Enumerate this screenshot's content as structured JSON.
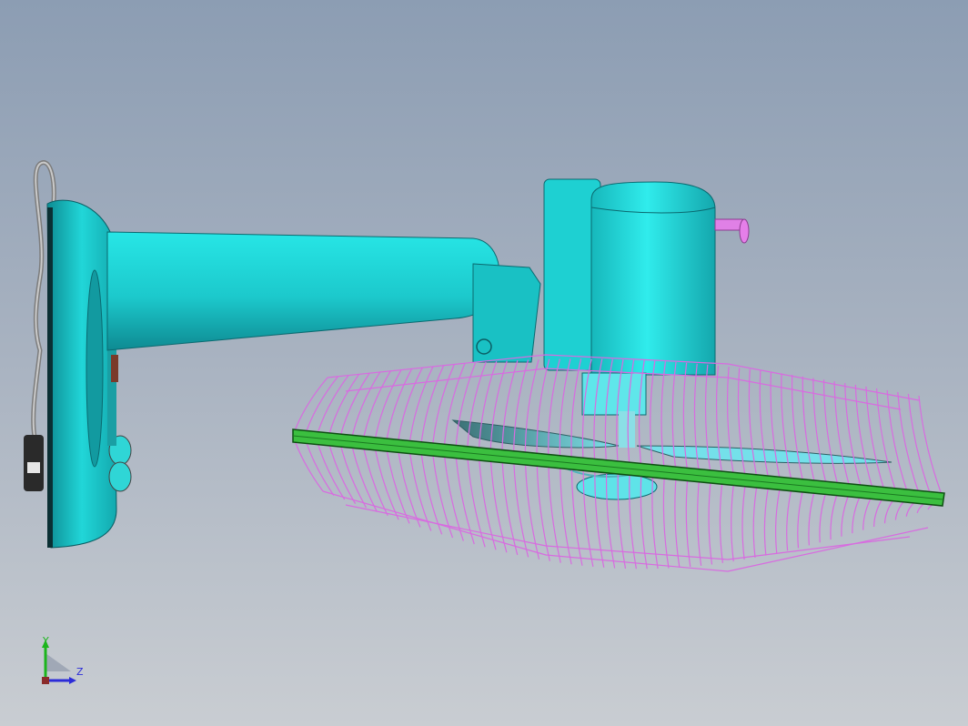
{
  "viewport": {
    "background_top": "#8c9db3",
    "background_bottom": "#c9cdd2"
  },
  "model": {
    "parts": [
      "power-cord-icon",
      "wall-mount-base",
      "support-arm",
      "pivot-bracket",
      "motor-housing",
      "rear-shaft",
      "fan-blades",
      "fan-guard-rim",
      "fan-guard-wires"
    ],
    "colors": {
      "body": "#1fd3d3",
      "body_dark": "#0d8f96",
      "guard": "#d86be0",
      "rim": "#2fb53a",
      "cord": "#8e8e8e",
      "plug": "#2a2a2a"
    }
  },
  "triad": {
    "y_label": "Y",
    "z_label": "Z",
    "y_color": "#1cb51c",
    "z_color": "#2c2cd8"
  }
}
